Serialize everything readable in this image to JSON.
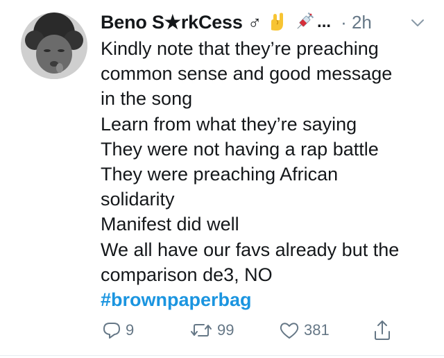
{
  "tweet": {
    "author_name": "Beno S★rkCess ♂",
    "name_ellipsis": "...",
    "separator_and_time": "· 2h",
    "emoji": [
      "sign-of-the-horns-emoji",
      "syringe-emoji"
    ],
    "lines": [
      "Kindly note that they’re preaching",
      "common sense and good message",
      "in the song",
      "Learn from what they’re saying",
      "They were not having a rap battle",
      "They were preaching African",
      "solidarity",
      "Manifest did well",
      "We all have our favs already but the",
      "comparison de3, NO"
    ],
    "hashtag": "#brownpaperbag",
    "actions": {
      "reply_count": "9",
      "retweet_count": "99",
      "like_count": "381"
    }
  },
  "colors": {
    "text": "#14171a",
    "muted": "#657786",
    "link": "#1b95e0",
    "divider": "#e6ecf0"
  },
  "icons": [
    "reply-icon",
    "retweet-icon",
    "like-icon",
    "share-icon",
    "chevron-down-icon"
  ]
}
